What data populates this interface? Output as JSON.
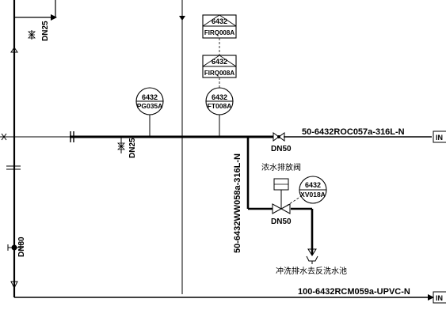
{
  "drawing": {
    "top_left_size_label": "DN25",
    "header_size_label": "DN25",
    "vent_size_label": "DN80",
    "instruments": [
      {
        "id": "pg035a",
        "number": "6432",
        "tag": "PG035A"
      },
      {
        "id": "ft008a",
        "number": "6432",
        "tag": "FT008A"
      },
      {
        "id": "firq008a-upper",
        "number": "6432",
        "tag": "FIRQ008A"
      },
      {
        "id": "firq008a-lower",
        "number": "6432",
        "tag": "FIRQ008A"
      },
      {
        "id": "xv018a",
        "number": "6432",
        "tag": "XV018A"
      }
    ],
    "lines": {
      "outlet_line": "50-6432ROC057a-316L-N",
      "drain_line": "50-6432WW058a-316L-N",
      "bottom_line": "100-6432RCM059a-UPVC-N"
    },
    "valves": {
      "outlet_valve_size": "DN50",
      "drain_valve_size": "DN50",
      "drain_valve_caption": "浓水排放阀"
    },
    "destination_caption": "冲洗排水去反洗水池",
    "off_page_marker": "IN"
  }
}
